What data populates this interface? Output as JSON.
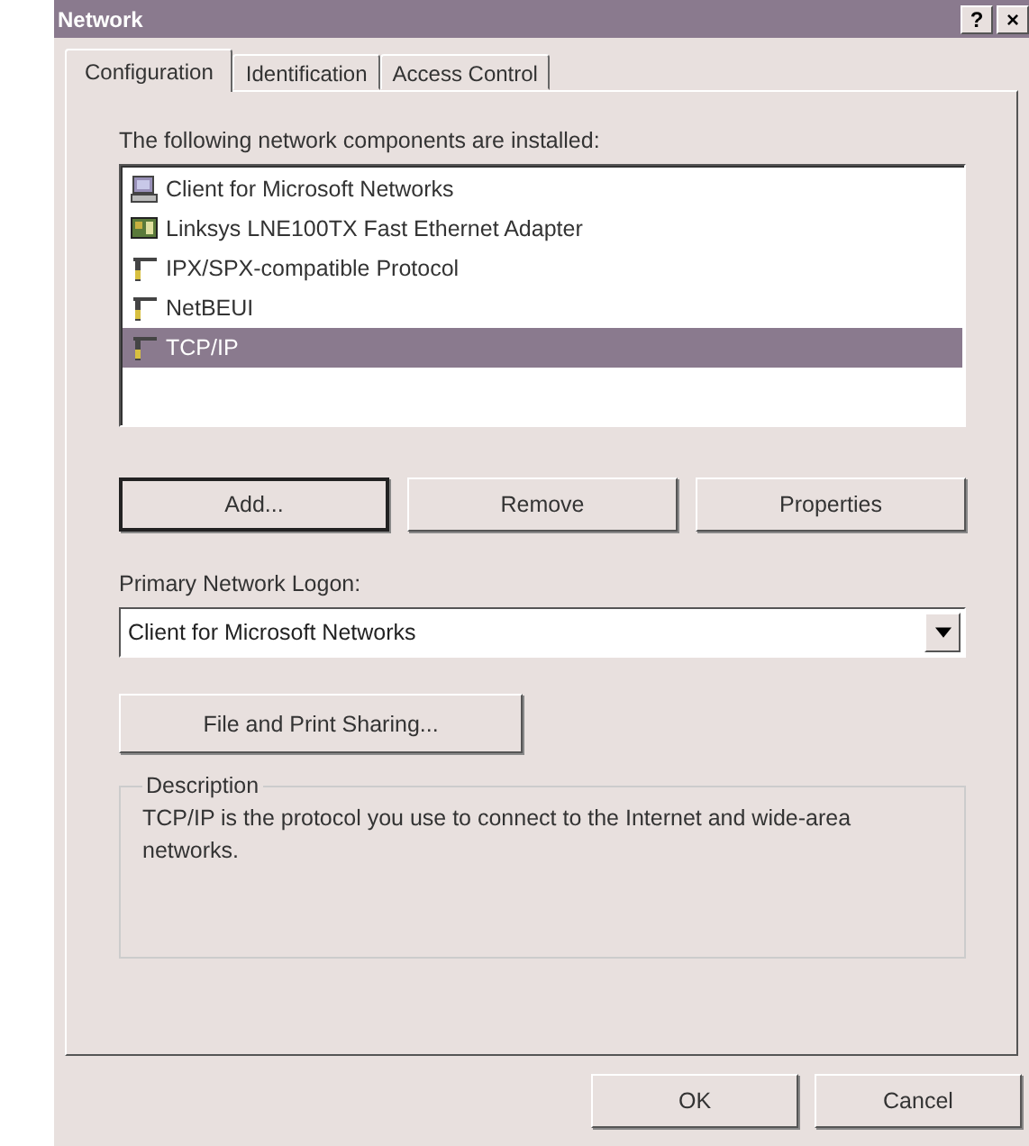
{
  "window": {
    "title": "Network",
    "help_button": "?",
    "close_button": "×"
  },
  "tabs": [
    {
      "label": "Configuration",
      "selected": true
    },
    {
      "label": "Identification",
      "selected": false
    },
    {
      "label": "Access Control",
      "selected": false
    }
  ],
  "components": {
    "label": "The following network components are installed:",
    "items": [
      {
        "label": "Client for Microsoft Networks",
        "kind": "client",
        "selected": false
      },
      {
        "label": "Linksys LNE100TX Fast Ethernet Adapter",
        "kind": "adapter",
        "selected": false
      },
      {
        "label": "IPX/SPX-compatible Protocol",
        "kind": "protocol",
        "selected": false
      },
      {
        "label": "NetBEUI",
        "kind": "protocol",
        "selected": false
      },
      {
        "label": "TCP/IP",
        "kind": "protocol",
        "selected": true
      }
    ]
  },
  "component_buttons": [
    "Add...",
    "Remove",
    "Properties"
  ],
  "primary_logon": {
    "label": "Primary Network Logon:",
    "value": "Client for Microsoft Networks"
  },
  "sharing_button": "File and Print Sharing...",
  "description": {
    "title": "Description",
    "text": "TCP/IP is the protocol you use to connect to the Internet and wide-area networks."
  },
  "dialog_buttons": [
    "OK",
    "Cancel"
  ]
}
